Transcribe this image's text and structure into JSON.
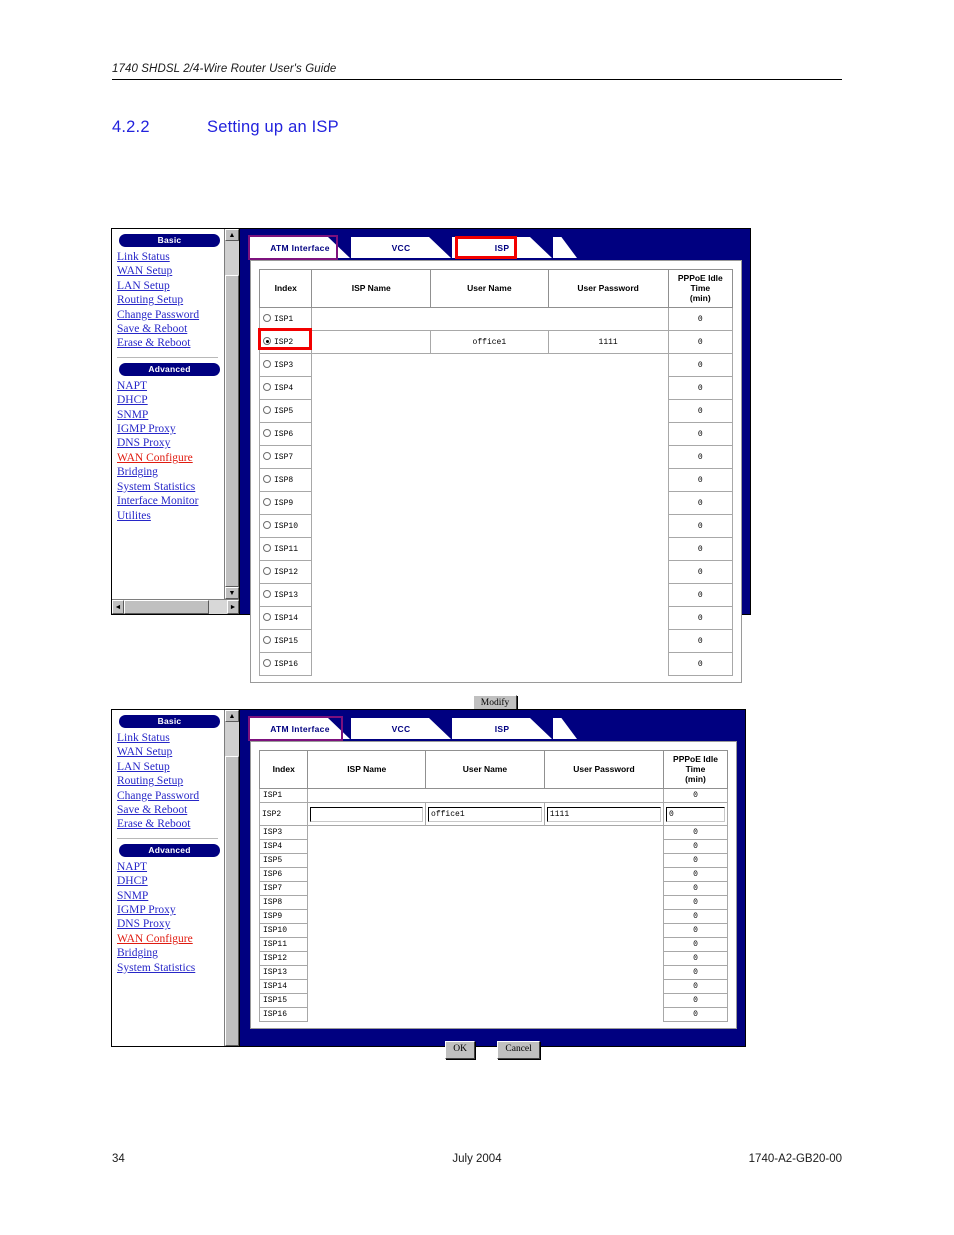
{
  "document": {
    "header": "1740 SHDSL 2/4-Wire Router User's Guide",
    "section_number": "4.2.2",
    "section_title": "Setting up an ISP",
    "footer_page": "34",
    "footer_date": "July 2004",
    "footer_doc_id": "1740-A2-GB20-00"
  },
  "colors": {
    "panel_blue": "#000080",
    "link_blue": "#2727c8",
    "active_link_red": "#e01b10",
    "annotation_red": "#f20000",
    "annotation_purple": "#7d117d",
    "heading_blue": "#2222dd"
  },
  "sidebar": {
    "basic_label": "Basic",
    "advanced_label": "Advanced",
    "basic_items": [
      {
        "label": "Link Status"
      },
      {
        "label": "WAN Setup"
      },
      {
        "label": "LAN Setup"
      },
      {
        "label": "Routing Setup"
      },
      {
        "label": "Change Password"
      },
      {
        "label": "Save & Reboot"
      },
      {
        "label": "Erase & Reboot"
      }
    ],
    "advanced_items_full": [
      {
        "label": "NAPT"
      },
      {
        "label": "DHCP"
      },
      {
        "label": "SNMP"
      },
      {
        "label": "IGMP Proxy"
      },
      {
        "label": "DNS Proxy"
      },
      {
        "label": "WAN Configure"
      },
      {
        "label": "Bridging"
      },
      {
        "label": "System Statistics"
      },
      {
        "label": "Interface Monitor"
      },
      {
        "label": "Utilites"
      }
    ],
    "advanced_items_clipped": [
      {
        "label": "NAPT"
      },
      {
        "label": "DHCP"
      },
      {
        "label": "SNMP"
      },
      {
        "label": "IGMP Proxy"
      },
      {
        "label": "DNS Proxy"
      },
      {
        "label": "WAN Configure"
      },
      {
        "label": "Bridging"
      },
      {
        "label": "System Statistics"
      }
    ],
    "active_item": "WAN Configure",
    "scroll_up_glyph": "▲",
    "scroll_down_glyph": "▼",
    "scroll_left_glyph": "◄",
    "scroll_right_glyph": "►"
  },
  "tabs": {
    "atm": "ATM Interface",
    "vcc": "VCC",
    "isp": "ISP"
  },
  "table": {
    "headers": {
      "index": "Index",
      "isp_name": "ISP Name",
      "user_name": "User Name",
      "user_password": "User Password",
      "idle_line1": "PPPoE Idle",
      "idle_line2": "Time",
      "idle_line3": "(min)"
    },
    "rows": [
      {
        "index": "ISP1",
        "isp_name": "",
        "user_name": "",
        "user_password": "",
        "idle": "0",
        "selected": false
      },
      {
        "index": "ISP2",
        "isp_name": "",
        "user_name": "office1",
        "user_password": "1111",
        "idle": "0",
        "selected": true
      },
      {
        "index": "ISP3",
        "isp_name": "",
        "user_name": "",
        "user_password": "",
        "idle": "0",
        "selected": false
      },
      {
        "index": "ISP4",
        "isp_name": "",
        "user_name": "",
        "user_password": "",
        "idle": "0",
        "selected": false
      },
      {
        "index": "ISP5",
        "isp_name": "",
        "user_name": "",
        "user_password": "",
        "idle": "0",
        "selected": false
      },
      {
        "index": "ISP6",
        "isp_name": "",
        "user_name": "",
        "user_password": "",
        "idle": "0",
        "selected": false
      },
      {
        "index": "ISP7",
        "isp_name": "",
        "user_name": "",
        "user_password": "",
        "idle": "0",
        "selected": false
      },
      {
        "index": "ISP8",
        "isp_name": "",
        "user_name": "",
        "user_password": "",
        "idle": "0",
        "selected": false
      },
      {
        "index": "ISP9",
        "isp_name": "",
        "user_name": "",
        "user_password": "",
        "idle": "0",
        "selected": false
      },
      {
        "index": "ISP10",
        "isp_name": "",
        "user_name": "",
        "user_password": "",
        "idle": "0",
        "selected": false
      },
      {
        "index": "ISP11",
        "isp_name": "",
        "user_name": "",
        "user_password": "",
        "idle": "0",
        "selected": false
      },
      {
        "index": "ISP12",
        "isp_name": "",
        "user_name": "",
        "user_password": "",
        "idle": "0",
        "selected": false
      },
      {
        "index": "ISP13",
        "isp_name": "",
        "user_name": "",
        "user_password": "",
        "idle": "0",
        "selected": false
      },
      {
        "index": "ISP14",
        "isp_name": "",
        "user_name": "",
        "user_password": "",
        "idle": "0",
        "selected": false
      },
      {
        "index": "ISP15",
        "isp_name": "",
        "user_name": "",
        "user_password": "",
        "idle": "0",
        "selected": false
      },
      {
        "index": "ISP16",
        "isp_name": "",
        "user_name": "",
        "user_password": "",
        "idle": "0",
        "selected": false
      }
    ]
  },
  "buttons": {
    "modify": "Modify",
    "ok": "OK",
    "cancel": "Cancel"
  }
}
